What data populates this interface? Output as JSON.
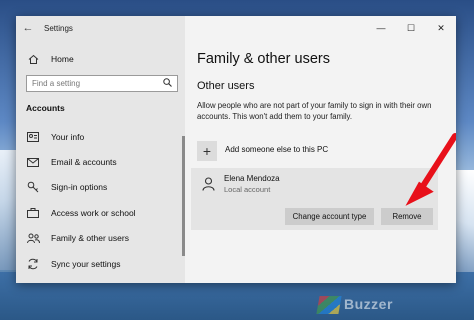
{
  "window": {
    "title": "Settings"
  },
  "sidebar": {
    "home_label": "Home",
    "search_placeholder": "Find a setting",
    "section_title": "Accounts",
    "items": [
      {
        "label": "Your info",
        "icon": "user-card-icon"
      },
      {
        "label": "Email & accounts",
        "icon": "mail-icon"
      },
      {
        "label": "Sign-in options",
        "icon": "key-icon"
      },
      {
        "label": "Access work or school",
        "icon": "briefcase-icon"
      },
      {
        "label": "Family & other users",
        "icon": "people-icon"
      },
      {
        "label": "Sync your settings",
        "icon": "sync-icon"
      }
    ]
  },
  "main": {
    "page_title": "Family & other users",
    "section_title": "Other users",
    "description": "Allow people who are not part of your family to sign in with their own accounts. This won't add them to your family.",
    "add_label": "Add someone else to this PC",
    "user": {
      "name": "Elena Mendoza",
      "account_type": "Local account",
      "change_button": "Change account type",
      "remove_button": "Remove"
    }
  },
  "watermark": "Buzzer",
  "colors": {
    "sidebar_bg": "#e6e6e6",
    "content_bg": "#f3f3f3",
    "button_bg": "#cccccc",
    "arrow": "#e8101a"
  }
}
